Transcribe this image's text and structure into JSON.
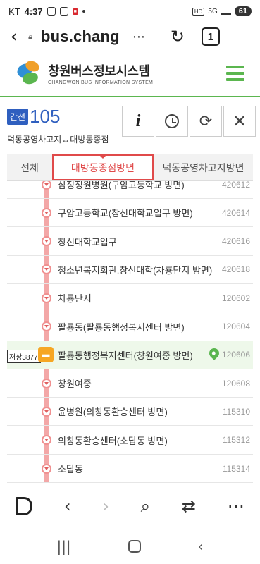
{
  "status_bar": {
    "carrier": "KT",
    "time": "4:37",
    "network": "5G",
    "battery": "61"
  },
  "browser": {
    "url": "bus.chang",
    "tabs_count": "1",
    "more": "⋯"
  },
  "site": {
    "title_kr": "창원버스정보시스템",
    "title_en": "CHANGWON BUS INFORMATION SYSTEM",
    "accent_color": "#5bb64f"
  },
  "route": {
    "type": "간선",
    "number": "105",
    "description": "덕동공영차고지↔대방동종점"
  },
  "route_buttons": [
    "info-icon",
    "clock-icon",
    "refresh-icon",
    "close-icon"
  ],
  "tabs": {
    "all": "전체",
    "active": "대방동종점방면",
    "other": "덕동공영차고지방면"
  },
  "stops": [
    {
      "name": "삼정정원병원(구암고등학교 방면)",
      "code": "420612"
    },
    {
      "name": "구암고등학교(창신대학교입구 방면)",
      "code": "420614"
    },
    {
      "name": "창신대학교입구",
      "code": "420616"
    },
    {
      "name": "청소년복지회관.창신대학(차룡단지 방면)",
      "code": "420618"
    },
    {
      "name": "차룡단지",
      "code": "120602"
    },
    {
      "name": "팔룡동(팔룡동행정복지센터 방면)",
      "code": "120604"
    },
    {
      "name": "팔룡동행정복지센터(창원여중 방면)",
      "code": "120606"
    },
    {
      "name": "창원여중",
      "code": "120608"
    },
    {
      "name": "윤병원(의창동환승센터 방면)",
      "code": "115310"
    },
    {
      "name": "의창동환승센터(소답동 방면)",
      "code": "115312"
    },
    {
      "name": "소답동",
      "code": "115314"
    }
  ],
  "current_bus": {
    "plate": "저상3877",
    "stop_index": 6
  }
}
